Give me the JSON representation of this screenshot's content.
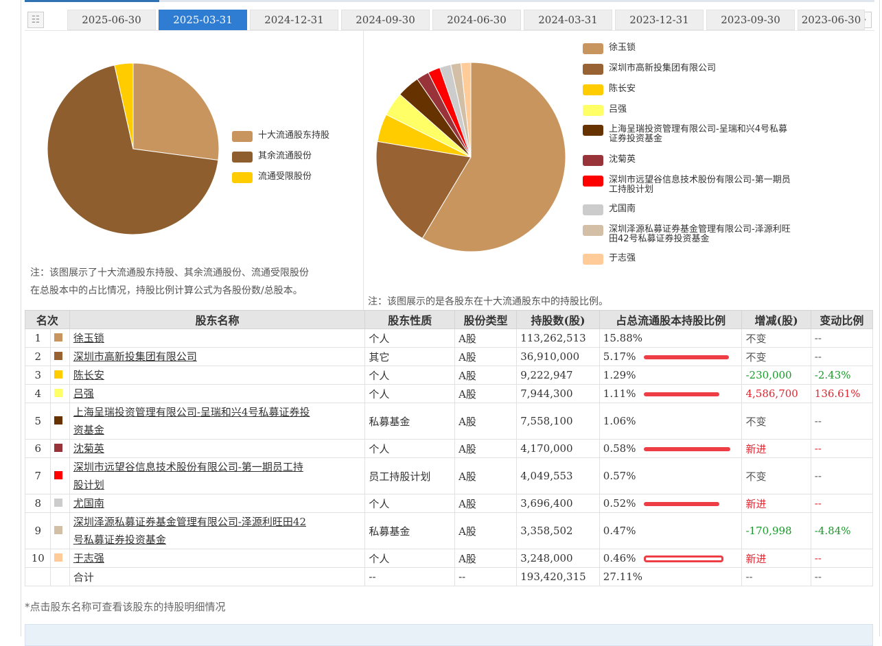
{
  "tabs": [
    "2025-06-30",
    "2025-03-31",
    "2024-12-31",
    "2024-09-30",
    "2024-06-30",
    "2024-03-31",
    "2023-12-31",
    "2023-09-30",
    "2023-06-30"
  ],
  "active_tab_index": 1,
  "icons": {
    "tab_menu": "list-icon",
    "tab_next": "double-chevron-right-icon"
  },
  "chart1": {
    "legend": [
      "十大流通股东持股",
      "其余流通股份",
      "流通受限股份"
    ],
    "note_line1": "注：该图展示了十大流通股东持股、其余流通股份、流通受限股份",
    "note_line2": "在总股本中的占比情况，持股比例计算公式为各股份数/总股本。"
  },
  "chart2": {
    "note": "注：该图展示的是各股东在十大流通股东中的持股比例。",
    "legend": [
      [
        "徐玉锁"
      ],
      [
        "深圳市高新投集团有限公司"
      ],
      [
        "陈长安"
      ],
      [
        "吕强"
      ],
      [
        "上海呈瑞投资管理有限公司-呈瑞和兴4号私募",
        "证券投资基金"
      ],
      [
        "沈菊英"
      ],
      [
        "深圳市远望谷信息技术股份有限公司-第一期员",
        "工持股计划"
      ],
      [
        "尤国南"
      ],
      [
        "深圳泽源私募证券基金管理有限公司-泽源利旺",
        "田42号私募证券投资基金"
      ],
      [
        "于志强"
      ]
    ]
  },
  "chart_data": [
    {
      "type": "pie",
      "labels": [
        "十大流通股东持股",
        "其余流通股份",
        "流通受限股份"
      ],
      "values": [
        27.11,
        69.4,
        3.49
      ],
      "colors": [
        "#c9955f",
        "#8f5e2f",
        "#ffcc00"
      ]
    },
    {
      "type": "pie",
      "labels": [
        "徐玉锁",
        "深圳市高新投集团有限公司",
        "陈长安",
        "吕强",
        "上海呈瑞投资管理有限公司-呈瑞和兴4号私募证券投资基金",
        "沈菊英",
        "深圳市远望谷信息技术股份有限公司-第一期员工持股计划",
        "尤国南",
        "深圳泽源私募证券基金管理有限公司-泽源利旺田42号私募证券投资基金",
        "于志强"
      ],
      "values": [
        113262513,
        36910000,
        9222947,
        7944300,
        7558100,
        4170000,
        4049553,
        3696400,
        3358502,
        3248000
      ],
      "colors": [
        "#c9955f",
        "#986232",
        "#ffcc00",
        "#ffff66",
        "#663300",
        "#99333a",
        "#ff0000",
        "#cccccc",
        "#d2bfa5",
        "#ffcc99"
      ]
    }
  ],
  "table": {
    "headers": [
      "名次",
      "股东名称",
      "股东性质",
      "股份类型",
      "持股数(股)",
      "占总流通股本持股比例",
      "增减(股)",
      "变动比例"
    ],
    "rows": [
      {
        "rank": "1",
        "color": "#c9955f",
        "name": [
          "徐玉锁"
        ],
        "nature": "个人",
        "type": "A股",
        "shares": "113,262,513",
        "ratio": "15.88%",
        "bar": 0,
        "change": "不变",
        "change_cls": "gray",
        "pct": "--",
        "pct_cls": "gray"
      },
      {
        "rank": "2",
        "color": "#986232",
        "name": [
          "深圳市高新投集团有限公司"
        ],
        "nature": "其它",
        "type": "A股",
        "shares": "36,910,000",
        "ratio": "5.17%",
        "bar": 124,
        "change": "不变",
        "change_cls": "gray",
        "pct": "--",
        "pct_cls": "gray"
      },
      {
        "rank": "3",
        "color": "#ffcc00",
        "name": [
          "陈长安"
        ],
        "nature": "个人",
        "type": "A股",
        "shares": "9,222,947",
        "ratio": "1.29%",
        "bar": 0,
        "change": "-230,000",
        "change_cls": "neg",
        "pct": "-2.43%",
        "pct_cls": "neg"
      },
      {
        "rank": "4",
        "color": "#ffff66",
        "name": [
          "吕强"
        ],
        "nature": "个人",
        "type": "A股",
        "shares": "7,944,300",
        "ratio": "1.11%",
        "bar": 110,
        "change": "4,586,700",
        "change_cls": "pos",
        "pct": "136.61%",
        "pct_cls": "pos"
      },
      {
        "rank": "5",
        "color": "#663300",
        "name": [
          "上海呈瑞投资管理有限公司-呈瑞和兴4号私募证券投",
          "资基金"
        ],
        "nature": "私募基金",
        "type": "A股",
        "shares": "7,558,100",
        "ratio": "1.06%",
        "bar": 0,
        "change": "不变",
        "change_cls": "gray",
        "pct": "--",
        "pct_cls": "gray"
      },
      {
        "rank": "6",
        "color": "#99333a",
        "name": [
          "沈菊英"
        ],
        "nature": "个人",
        "type": "A股",
        "shares": "4,170,000",
        "ratio": "0.58%",
        "bar": 126,
        "change": "新进",
        "change_cls": "pos",
        "pct": "--",
        "pct_cls": "pos"
      },
      {
        "rank": "7",
        "color": "#ff0000",
        "name": [
          "深圳市远望谷信息技术股份有限公司-第一期员工持",
          "股计划"
        ],
        "nature": "员工持股计划",
        "type": "A股",
        "shares": "4,049,553",
        "ratio": "0.57%",
        "bar": 0,
        "change": "不变",
        "change_cls": "gray",
        "pct": "--",
        "pct_cls": "gray"
      },
      {
        "rank": "8",
        "color": "#cccccc",
        "name": [
          "尤国南"
        ],
        "nature": "个人",
        "type": "A股",
        "shares": "3,696,400",
        "ratio": "0.52%",
        "bar": 110,
        "change": "新进",
        "change_cls": "pos",
        "pct": "--",
        "pct_cls": "pos"
      },
      {
        "rank": "9",
        "color": "#d2bfa5",
        "name": [
          "深圳泽源私募证券基金管理有限公司-泽源利旺田42",
          "号私募证券投资基金"
        ],
        "nature": "私募基金",
        "type": "A股",
        "shares": "3,358,502",
        "ratio": "0.47%",
        "bar": 0,
        "change": "-170,998",
        "change_cls": "neg",
        "pct": "-4.84%",
        "pct_cls": "neg"
      },
      {
        "rank": "10",
        "color": "#ffcc99",
        "name": [
          "于志强"
        ],
        "nature": "个人",
        "type": "A股",
        "shares": "3,248,000",
        "ratio": "0.46%",
        "bar": -110,
        "change": "新进",
        "change_cls": "pos",
        "pct": "--",
        "pct_cls": "pos"
      }
    ],
    "total": {
      "label": "合计",
      "nature": "--",
      "type": "--",
      "shares": "193,420,315",
      "ratio": "27.11%",
      "change": "--",
      "pct": "--"
    }
  },
  "footnote": "*点击股东名称可查看该股东的持股明细情况"
}
